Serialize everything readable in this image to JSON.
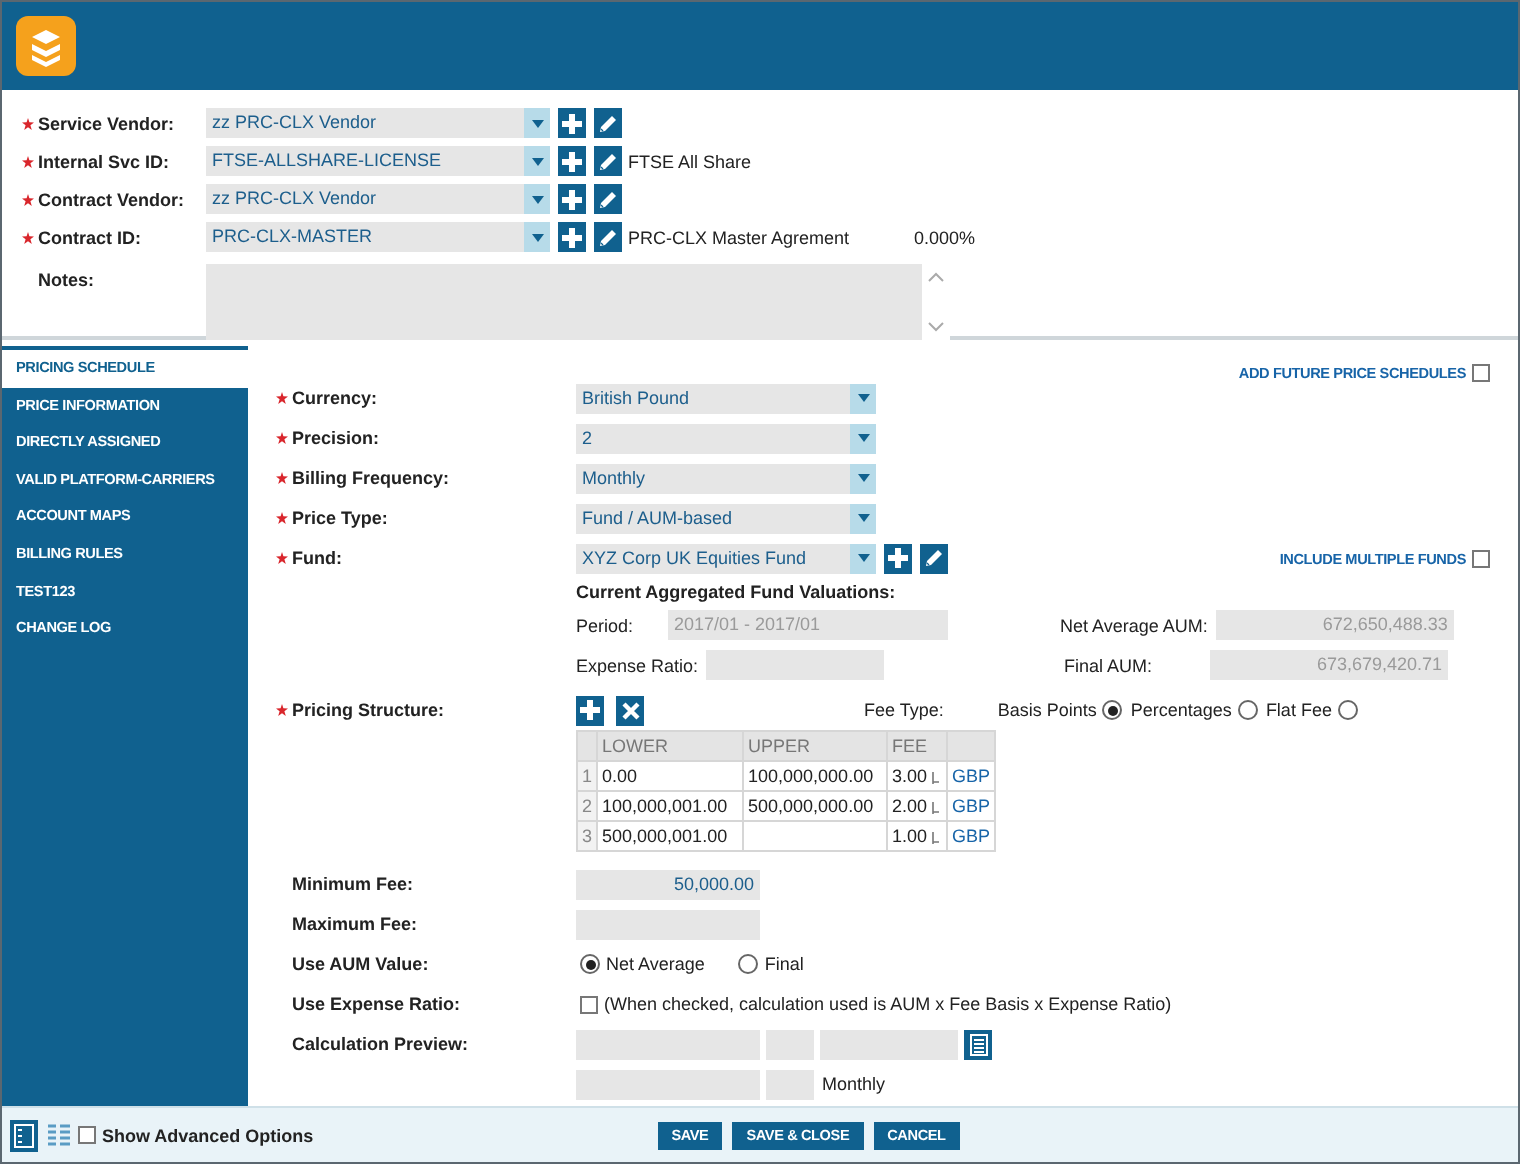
{
  "top_fields": [
    {
      "label": "Service Vendor:",
      "required": true,
      "value": "zz PRC-CLX Vendor"
    },
    {
      "label": "Internal Svc ID:",
      "required": true,
      "value": "FTSE-ALLSHARE-LICENSE",
      "description": "FTSE All Share"
    },
    {
      "label": "Contract Vendor:",
      "required": true,
      "value": "zz PRC-CLX Vendor"
    },
    {
      "label": "Contract ID:",
      "required": true,
      "value": "PRC-CLX-MASTER",
      "description": "PRC-CLX Master Agrement",
      "rate": "0.000%"
    }
  ],
  "notes": {
    "label": "Notes:"
  },
  "sidebar": {
    "items": [
      {
        "label": "PRICING SCHEDULE",
        "selected": true
      },
      {
        "label": "PRICE INFORMATION",
        "selected": false
      },
      {
        "label": "DIRECTLY ASSIGNED",
        "selected": false
      },
      {
        "label": "VALID PLATFORM-CARRIERS",
        "selected": false
      },
      {
        "label": "ACCOUNT MAPS",
        "selected": false
      },
      {
        "label": "BILLING RULES",
        "selected": false
      },
      {
        "label": "TEST123",
        "selected": false
      },
      {
        "label": "CHANGE LOG",
        "selected": false
      }
    ]
  },
  "pricing": {
    "add_future": {
      "label": "ADD FUTURE PRICE SCHEDULES",
      "checked": false
    },
    "fields": [
      {
        "label": "Currency:",
        "required": true,
        "value": "British Pound"
      },
      {
        "label": "Precision:",
        "required": true,
        "value": "2"
      },
      {
        "label": "Billing Frequency:",
        "required": true,
        "value": "Monthly"
      },
      {
        "label": "Price Type:",
        "required": true,
        "value": "Fund / AUM-based"
      },
      {
        "label": "Fund:",
        "required": true,
        "value": "XYZ Corp UK Equities Fund"
      }
    ],
    "include_multiple_funds": {
      "label": "INCLUDE MULTIPLE FUNDS",
      "checked": false
    },
    "valuations": {
      "title": "Current Aggregated Fund Valuations:",
      "period": {
        "label": "Period:",
        "value": "2017/01 - 2017/01"
      },
      "expense_ratio": {
        "label": "Expense Ratio:"
      },
      "net_average_aum": {
        "label": "Net Average AUM:",
        "value": "672,650,488.33"
      },
      "final_aum": {
        "label": "Final AUM:",
        "value": "673,679,420.71"
      }
    },
    "pricing_structure": {
      "label": "Pricing Structure:",
      "required": true,
      "fee_type_label": "Fee Type:",
      "fee_types": [
        {
          "label": "Basis Points",
          "selected": true
        },
        {
          "label": "Percentages",
          "selected": false
        },
        {
          "label": "Flat Fee",
          "selected": false
        }
      ],
      "table": {
        "columns": [
          "LOWER",
          "UPPER",
          "FEE"
        ],
        "rows": [
          {
            "index": "1",
            "lower": "0.00",
            "upper": "100,000,000.00",
            "fee": "3.00",
            "currency": "GBP"
          },
          {
            "index": "2",
            "lower": "100,000,001.00",
            "upper": "500,000,000.00",
            "fee": "2.00",
            "currency": "GBP"
          },
          {
            "index": "3",
            "lower": "500,000,001.00",
            "fee": "1.00",
            "currency": "GBP"
          }
        ]
      }
    },
    "minimum_fee": {
      "label": "Minimum Fee:",
      "value": "50,000.00"
    },
    "maximum_fee": {
      "label": "Maximum Fee:"
    },
    "use_aum_value": {
      "label": "Use AUM Value:",
      "options": [
        {
          "label": "Net Average",
          "selected": true
        },
        {
          "label": "Final",
          "selected": false
        }
      ]
    },
    "use_expense_ratio": {
      "label": "Use Expense Ratio:",
      "checked": false,
      "note": "(When checked, calculation used is AUM x Fee Basis x Expense Ratio)"
    },
    "calculation_preview": {
      "label": "Calculation Preview:",
      "frequency": "Monthly"
    }
  },
  "footer": {
    "view_modes": [
      {
        "selected": true
      },
      {
        "selected": false
      }
    ],
    "show_advanced": {
      "label": "Show Advanced Options",
      "checked": false
    },
    "buttons": [
      "SAVE",
      "SAVE & CLOSE",
      "CANCEL"
    ]
  }
}
